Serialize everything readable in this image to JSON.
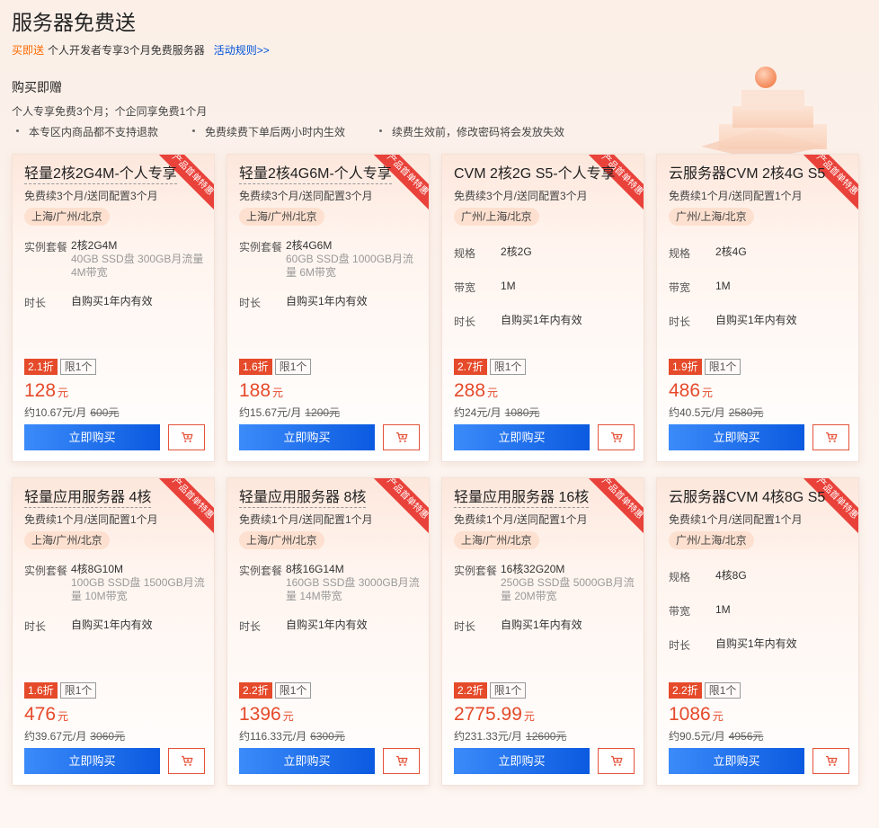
{
  "page": {
    "title": "服务器免费送",
    "sub_tag": "买即送",
    "sub_text": "个人开发者专享3个月免费服务器",
    "rules_link": "活动规则>>",
    "section_title": "购买即赠",
    "section_desc": "个人专享免费3个月；个企同享免费1个月",
    "notes": [
      "本专区内商品都不支持退款",
      "免费续费下单后两小时内生效",
      "续费生效前，修改密码将会发放失效"
    ]
  },
  "cards": [
    {
      "ribbon": "产品首单特惠",
      "title": "轻量2核2G4M-个人专享",
      "sub": "免费续3个月/送同配置3个月",
      "region": "上海/广州/北京",
      "rows": [
        {
          "label": "实例套餐",
          "value": "2核2G4M",
          "detail": "40GB SSD盘 300GB月流量 4M带宽"
        },
        {
          "label": "时长",
          "value": "自购买1年内有效",
          "detail": ""
        }
      ],
      "discount": "2.1折",
      "limit": "限1个",
      "price": "128",
      "unit": "元",
      "monthly": "约10.67元/月",
      "orig": "600元",
      "buy": "立即购买"
    },
    {
      "ribbon": "产品首单特惠",
      "title": "轻量2核4G6M-个人专享",
      "sub": "免费续3个月/送同配置3个月",
      "region": "上海/广州/北京",
      "rows": [
        {
          "label": "实例套餐",
          "value": "2核4G6M",
          "detail": "60GB SSD盘 1000GB月流量 6M带宽"
        },
        {
          "label": "时长",
          "value": "自购买1年内有效",
          "detail": ""
        }
      ],
      "discount": "1.6折",
      "limit": "限1个",
      "price": "188",
      "unit": "元",
      "monthly": "约15.67元/月",
      "orig": "1200元",
      "buy": "立即购买"
    },
    {
      "ribbon": "产品首单特惠",
      "title": "CVM 2核2G S5-个人专享",
      "sub": "免费续3个月/送同配置3个月",
      "region": "广州/上海/北京",
      "rows": [
        {
          "label": "规格",
          "value": "2核2G",
          "detail": ""
        },
        {
          "label": "带宽",
          "value": "1M",
          "detail": ""
        },
        {
          "label": "时长",
          "value": "自购买1年内有效",
          "detail": ""
        }
      ],
      "discount": "2.7折",
      "limit": "限1个",
      "price": "288",
      "unit": "元",
      "monthly": "约24元/月",
      "orig": "1080元",
      "buy": "立即购买"
    },
    {
      "ribbon": "产品首单特惠",
      "title": "云服务器CVM 2核4G S5",
      "sub": "免费续1个月/送同配置1个月",
      "region": "广州/上海/北京",
      "rows": [
        {
          "label": "规格",
          "value": "2核4G",
          "detail": ""
        },
        {
          "label": "带宽",
          "value": "1M",
          "detail": ""
        },
        {
          "label": "时长",
          "value": "自购买1年内有效",
          "detail": ""
        }
      ],
      "discount": "1.9折",
      "limit": "限1个",
      "price": "486",
      "unit": "元",
      "monthly": "约40.5元/月",
      "orig": "2580元",
      "buy": "立即购买"
    },
    {
      "ribbon": "产品首单特惠",
      "title": "轻量应用服务器 4核",
      "sub": "免费续1个月/送同配置1个月",
      "region": "上海/广州/北京",
      "rows": [
        {
          "label": "实例套餐",
          "value": "4核8G10M",
          "detail": "100GB SSD盘 1500GB月流量 10M带宽"
        },
        {
          "label": "时长",
          "value": "自购买1年内有效",
          "detail": ""
        }
      ],
      "discount": "1.6折",
      "limit": "限1个",
      "price": "476",
      "unit": "元",
      "monthly": "约39.67元/月",
      "orig": "3060元",
      "buy": "立即购买"
    },
    {
      "ribbon": "产品首单特惠",
      "title": "轻量应用服务器 8核",
      "sub": "免费续1个月/送同配置1个月",
      "region": "上海/广州/北京",
      "rows": [
        {
          "label": "实例套餐",
          "value": "8核16G14M",
          "detail": "160GB SSD盘 3000GB月流量 14M带宽"
        },
        {
          "label": "时长",
          "value": "自购买1年内有效",
          "detail": ""
        }
      ],
      "discount": "2.2折",
      "limit": "限1个",
      "price": "1396",
      "unit": "元",
      "monthly": "约116.33元/月",
      "orig": "6300元",
      "buy": "立即购买"
    },
    {
      "ribbon": "产品首单特惠",
      "title": "轻量应用服务器 16核",
      "sub": "免费续1个月/送同配置1个月",
      "region": "上海/广州/北京",
      "rows": [
        {
          "label": "实例套餐",
          "value": "16核32G20M",
          "detail": "250GB SSD盘 5000GB月流量 20M带宽"
        },
        {
          "label": "时长",
          "value": "自购买1年内有效",
          "detail": ""
        }
      ],
      "discount": "2.2折",
      "limit": "限1个",
      "price": "2775.99",
      "unit": "元",
      "monthly": "约231.33元/月",
      "orig": "12600元",
      "buy": "立即购买"
    },
    {
      "ribbon": "产品首单特惠",
      "title": "云服务器CVM 4核8G S5",
      "sub": "免费续1个月/送同配置1个月",
      "region": "广州/上海/北京",
      "rows": [
        {
          "label": "规格",
          "value": "4核8G",
          "detail": ""
        },
        {
          "label": "带宽",
          "value": "1M",
          "detail": ""
        },
        {
          "label": "时长",
          "value": "自购买1年内有效",
          "detail": ""
        }
      ],
      "discount": "2.2折",
      "limit": "限1个",
      "price": "1086",
      "unit": "元",
      "monthly": "约90.5元/月",
      "orig": "4956元",
      "buy": "立即购买"
    }
  ]
}
